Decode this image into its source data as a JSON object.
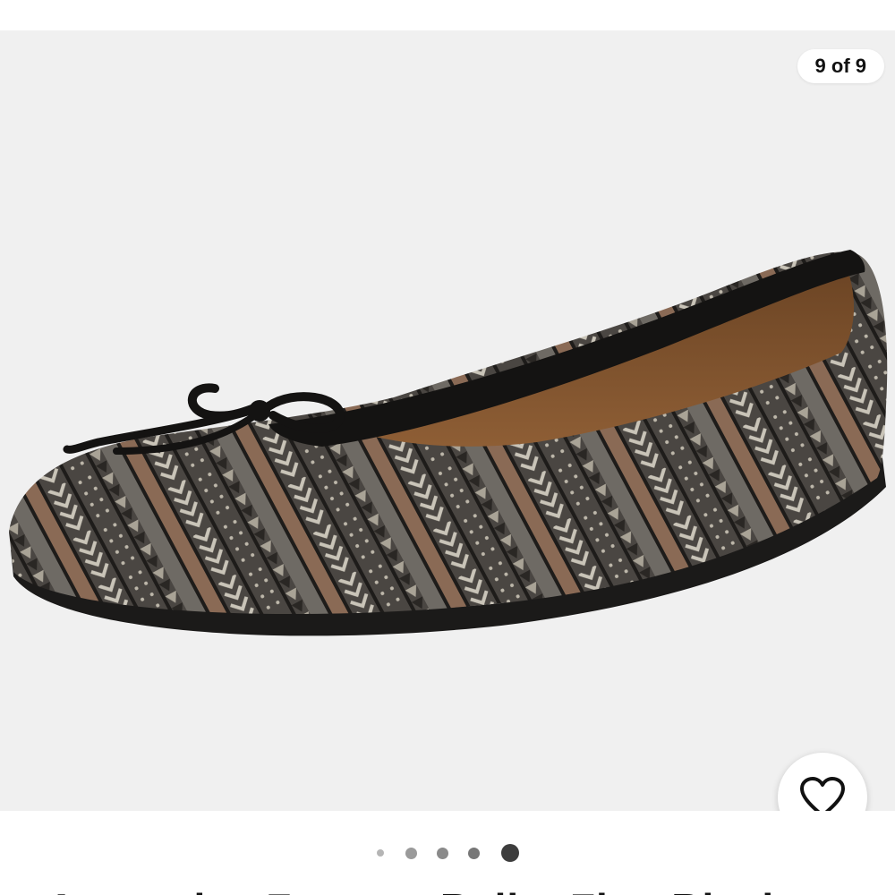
{
  "gallery": {
    "counter": "9 of 9",
    "current_index": 9,
    "total_images": 9,
    "image_alt": "Aerosoles Fantasy Ballet Flat",
    "background_color": "#f0f0f0"
  },
  "favorite": {
    "icon": "heart-outline-icon"
  },
  "pagination": {
    "dots": [
      {
        "active": false,
        "size": "small",
        "color": "#b5b5b5"
      },
      {
        "active": false,
        "size": "medium",
        "color": "#9a9a9a"
      },
      {
        "active": false,
        "size": "medium",
        "color": "#8a8a8a"
      },
      {
        "active": false,
        "size": "medium",
        "color": "#777777"
      },
      {
        "active": true,
        "size": "large",
        "color": "#3d3d3d"
      }
    ]
  },
  "product": {
    "title_partial": "Aerosoles Fantasy Ballet Flat, Black"
  },
  "colors": {
    "text": "#111111",
    "active_dot": "#3d3d3d"
  }
}
